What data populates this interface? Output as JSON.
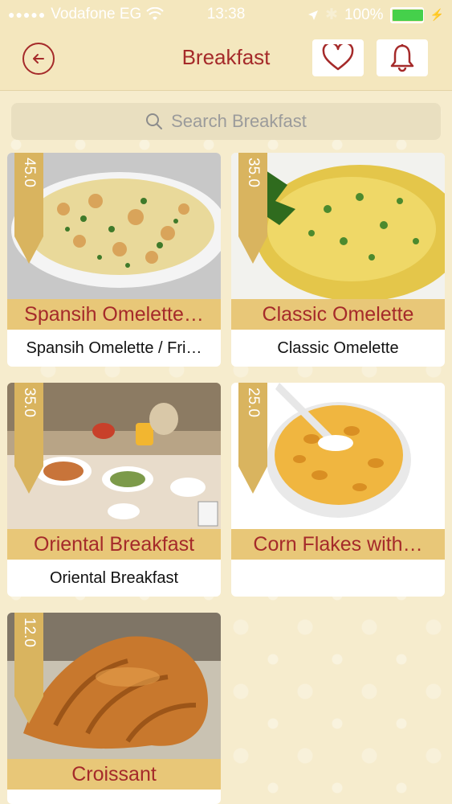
{
  "status_bar": {
    "carrier": "Vodafone EG",
    "time": "13:38",
    "battery": "100%"
  },
  "nav": {
    "title": "Breakfast"
  },
  "search": {
    "placeholder": "Search Breakfast"
  },
  "items": [
    {
      "price": "45.0",
      "name": "Spansih Omelette…",
      "subtitle": "Spansih Omelette / Fri…"
    },
    {
      "price": "35.0",
      "name": "Classic Omelette",
      "subtitle": "Classic Omelette"
    },
    {
      "price": "35.0",
      "name": "Oriental Breakfast",
      "subtitle": "Oriental Breakfast"
    },
    {
      "price": "25.0",
      "name": "Corn Flakes with…",
      "subtitle": ""
    },
    {
      "price": "12.0",
      "name": "Croissant",
      "subtitle": ""
    }
  ],
  "colors": {
    "accent": "#a52a2a",
    "tag": "#d9b45f",
    "name_bar": "#e8c778",
    "header_bg": "#f4e7be"
  }
}
